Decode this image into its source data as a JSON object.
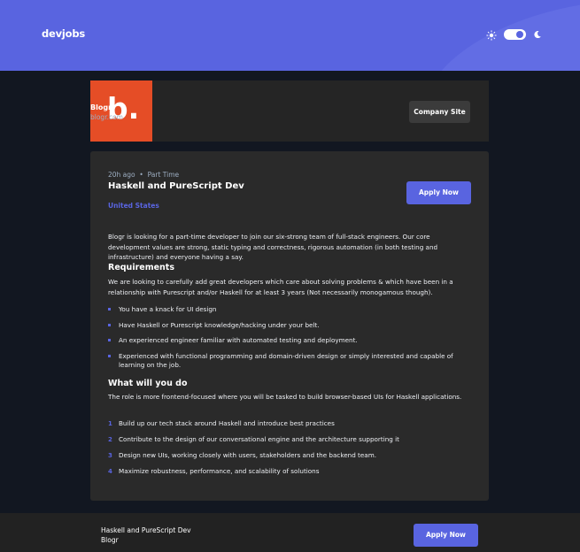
{
  "header": {
    "logo": "devjobs",
    "theme_toggle": {
      "state": "dark"
    },
    "icons": [
      "sun-icon",
      "moon-icon"
    ]
  },
  "company": {
    "logo_letter": "b.",
    "name": "Blogr",
    "url": "blogr.com",
    "site_button": "Company Site",
    "logo_color": "#E54D26"
  },
  "job": {
    "posted": "20h ago",
    "type": "Part Time",
    "title": "Haskell and PureScript Dev",
    "location": "United States",
    "apply_label": "Apply Now",
    "description": "Blogr is looking for a part-time developer to join our six-strong team of full-stack engineers. Our core development values are strong, static typing and correctness, rigorous automation (in both testing and infrastructure) and everyone having a say.",
    "requirements": {
      "heading": "Requirements",
      "content": "We are looking to carefully add great developers which care about solving problems & which have been in a relationship with Purescript and/or Haskell for at least 3 years (Not necessarily monogamous though).",
      "items": [
        "You have a knack for UI design",
        "Have Haskell or Purescript knowledge/hacking under your belt.",
        "An experienced engineer familiar with automated testing and deployment.",
        "Experienced with functional programming and domain-driven design or simply interested and capable of learning on the job."
      ]
    },
    "role": {
      "heading": "What will you do",
      "content": "The role is more frontend-focused where you will be tasked to build browser-based UIs for Haskell applications.",
      "items": [
        "Build up our tech stack around Haskell and introduce best practices",
        "Contribute to the design of our conversational engine and the architecture supporting it",
        "Design new UIs, working closely with users, stakeholders and the backend team.",
        "Maximize robustness, performance, and scalability of solutions"
      ]
    }
  },
  "footer": {
    "title": "Haskell and PureScript Dev",
    "company": "Blogr",
    "apply_label": "Apply Now"
  },
  "colors": {
    "accent": "#5964E0",
    "background": "#121721",
    "card": "#2A2A2A"
  }
}
